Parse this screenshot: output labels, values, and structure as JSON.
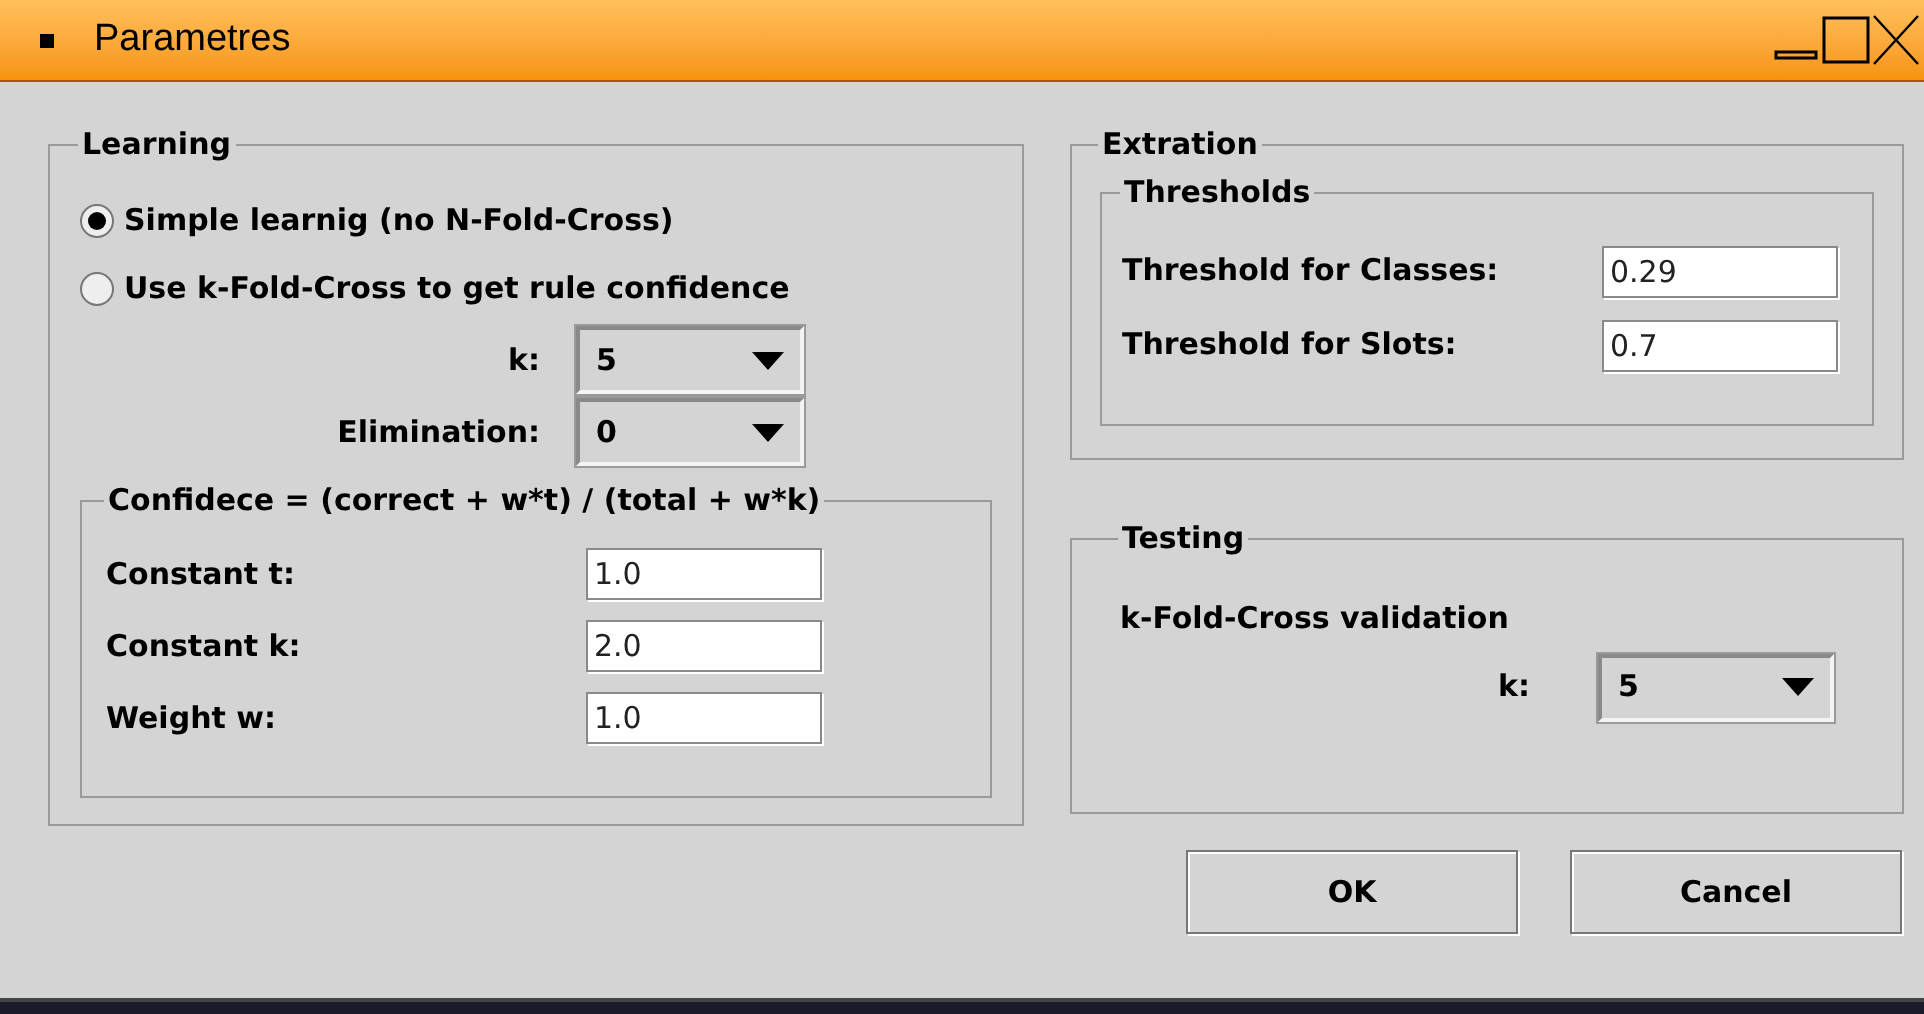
{
  "window": {
    "title": "Parametres"
  },
  "learning": {
    "title": "Learning",
    "options": [
      {
        "label": "Simple learnig (no N-Fold-Cross)",
        "selected": true
      },
      {
        "label": "Use k-Fold-Cross to get rule confidence",
        "selected": false
      }
    ],
    "selects": [
      {
        "label": "k:",
        "value": "5"
      },
      {
        "label": "Elimination:",
        "value": "0"
      }
    ],
    "confidence": {
      "title": "Confidece = (correct + w*t) / (total + w*k)",
      "fields": [
        {
          "label": "Constant t:",
          "value": "1.0"
        },
        {
          "label": "Constant k:",
          "value": "2.0"
        },
        {
          "label": "Weight w:",
          "value": "1.0"
        }
      ]
    }
  },
  "extraction": {
    "title": "Extration",
    "thresholds": {
      "title": "Thresholds",
      "fields": [
        {
          "label": "Threshold for Classes:",
          "value": "0.29"
        },
        {
          "label": "Threshold for Slots:",
          "value": "0.7"
        }
      ]
    }
  },
  "testing": {
    "title": "Testing",
    "subtitle": "k-Fold-Cross validation",
    "select": {
      "label": "k:",
      "value": "5"
    }
  },
  "buttons": [
    "OK",
    "Cancel"
  ]
}
